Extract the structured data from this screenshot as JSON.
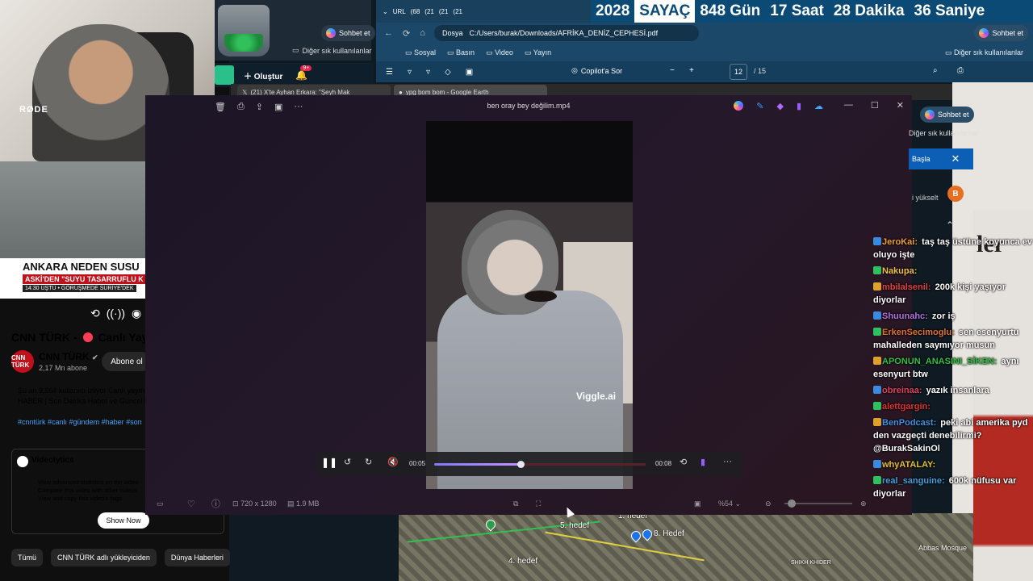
{
  "webcam": {
    "mic_brand": "RØDE"
  },
  "news": {
    "headline": "ANKARA NEDEN SUSU",
    "subheadline": "ASKİ'DEN \"SUYU TASARRUFLU K",
    "ticker_time": "14:30",
    "ticker_text": "ÜŞTÜ  •  GÖRÜŞMEDE SURİYE'DEK"
  },
  "youtube": {
    "title_prefix": "CNN TÜRK -",
    "title_suffix": "Canlı Yayın",
    "channel_logo": "CNN TÜRK",
    "channel_name": "CNN TÜRK",
    "subscribers": "2,17 Mn abone",
    "subscribe_label": "Abone ol",
    "description_line1": "Şu an 9.964 kullanıcı izliyor  Canlı yayın",
    "description_line2": "HABER | Son Dakika Haber ve Güncel H",
    "tags": "#cnntürk #canlı #gündem #haber #son",
    "videolytics_title": "Videolytics",
    "videolytics_items": [
      "View advanced statistics on the video",
      "Compare this video with other videos",
      "View and copy this video's tags"
    ],
    "show_now_label": "Show Now",
    "chips": [
      "Tümü",
      "CNN TÜRK adlı yükleyiciden",
      "Dünya Haberleri"
    ]
  },
  "browser_small": {
    "sohbet_label": "Sohbet et",
    "favorites_label": "Diğer sık kullanılanlar",
    "create_label": "Oluştur",
    "notif_count": "9+"
  },
  "countdown": {
    "year": "2028",
    "label": "SAYAÇ",
    "days": "848 Gün",
    "hours": "17 Saat",
    "minutes": "28 Dakika",
    "seconds": "36 Saniye"
  },
  "tabstrip": [
    "URL",
    "(68",
    "(21",
    "(21",
    "(21"
  ],
  "main_browser": {
    "url_prefix": "Dosya",
    "url": "C:/Users/burak/Downloads/AFRİKA_DENİZ_CEPHESİ.pdf",
    "sohbet_label": "Sohbet et",
    "favorites": [
      "Sosyal",
      "Basın",
      "Video",
      "Yayın"
    ],
    "favorites_right": "Diğer sık kullanılanlar",
    "copilot_label": "Copilot'a Sor",
    "page_current": "12",
    "page_total": "/ 15"
  },
  "back_window_tabs": [
    "(21) X'te Ayhan Erkara: \"Şeyh Mak",
    "ypg bom bom - Google Earth"
  ],
  "right_side": {
    "sohbet_label": "Sohbet et",
    "favorites_label": "Diğer sık kullanılanlar",
    "start_label": "Başla",
    "upgrade_label": "i yükselt",
    "avatar_letter": "B",
    "big_letter": "ler"
  },
  "player": {
    "title": "ben oray bey değilim.mp4",
    "watermark": "Viggle.ai",
    "current_time": "00:05",
    "duration": "00:08",
    "progress_fraction": 0.41,
    "resolution": "720 x 1280",
    "file_size": "1.9 MB",
    "zoom": "%54"
  },
  "map": {
    "labels": [
      "1. hedef",
      "5. hedef",
      "8. Hedef",
      "4. hedef",
      "Abbas Mosque",
      "SHIKH KHIDER"
    ]
  },
  "chat": [
    {
      "user": "JeroKai",
      "user_color": "#f0a030",
      "text": "taş taş üstüne koyunca ev oluyo işte"
    },
    {
      "user": "Nakupa",
      "user_color": "#f0c040",
      "text": ""
    },
    {
      "user": "mbilalsenil",
      "user_color": "#e04040",
      "text": "200k kişi yaşıyor diyorlar"
    },
    {
      "user": "Shuunahc",
      "user_color": "#b070e0",
      "text": "zor iş"
    },
    {
      "user": "ErkenSecimoglu",
      "user_color": "#e07030",
      "text": "sen esenyurtu mahalleden saymıyor musun"
    },
    {
      "user": "APONUN_ANASINI_SİKEN",
      "user_color": "#30c040",
      "text": "aynı esenyurt btw"
    },
    {
      "user": "obreinaa",
      "user_color": "#e04060",
      "text": "yazık insanlara"
    },
    {
      "user": "alettgargin",
      "user_color": "#e03030",
      "text": ""
    },
    {
      "user": "BenPodcast",
      "user_color": "#4090e0",
      "text": "peki abi amerika pyd den vazgeçti denebilirmi? @BurakSakinOl"
    },
    {
      "user": "whyATALAY",
      "user_color": "#e0c030",
      "text": ""
    },
    {
      "user": "real_sanguine",
      "user_color": "#40a0e0",
      "text": "600k nüfusu var diyorlar"
    }
  ]
}
